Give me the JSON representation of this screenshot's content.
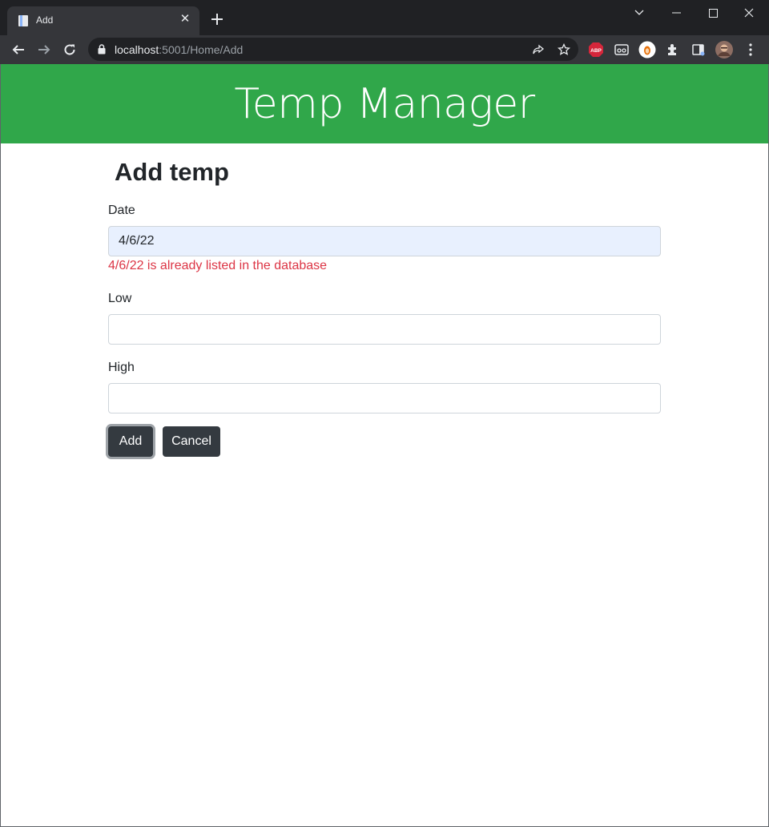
{
  "browser": {
    "tab_title": "Add",
    "tab_close": "✕",
    "url_host": "localhost",
    "url_path": ":5001/Home/Add",
    "abp_label": "ABP"
  },
  "page": {
    "banner_title": "Temp Manager",
    "heading": "Add temp",
    "date_label": "Date",
    "date_value": "4/6/22",
    "date_error": "4/6/22 is already listed in the database",
    "low_label": "Low",
    "low_value": "",
    "high_label": "High",
    "high_value": "",
    "add_button": "Add",
    "cancel_button": "Cancel"
  },
  "colors": {
    "banner": "#30a74a",
    "button": "#343a40",
    "error": "#dc3545",
    "autofill": "#e8f0fe"
  }
}
